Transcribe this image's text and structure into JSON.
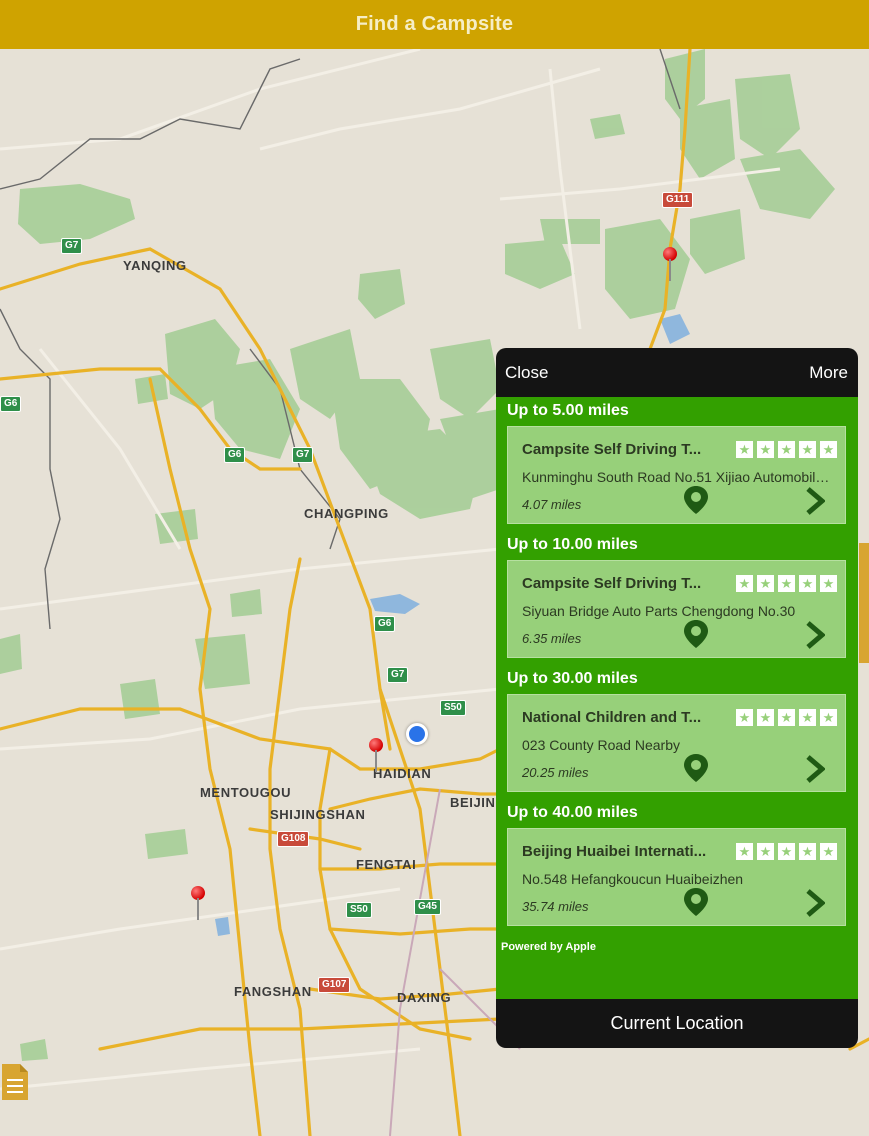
{
  "header": {
    "title": "Find a Campsite"
  },
  "map": {
    "cities": [
      {
        "name": "YANQING"
      },
      {
        "name": "CHANGPING"
      },
      {
        "name": "HAIDIAN"
      },
      {
        "name": "BEIJING"
      },
      {
        "name": "MENTOUGOU"
      },
      {
        "name": "SHIJINGSHAN"
      },
      {
        "name": "FENGTAI"
      },
      {
        "name": "FANGSHAN"
      },
      {
        "name": "DAXING"
      }
    ],
    "shields": [
      "G7",
      "G6",
      "G6",
      "G7",
      "G6",
      "G7",
      "S50",
      "G108",
      "S50",
      "G45",
      "G107",
      "G111"
    ]
  },
  "popover": {
    "close_label": "Close",
    "more_label": "More",
    "powered_by": "Powered by Apple",
    "current_location_label": "Current Location",
    "sections": [
      {
        "title": "Up to 5.00 miles",
        "name": "Campsite Self Driving T...",
        "address": "Kunminghu South Road No.51 Xijiao Automobile...",
        "distance": "4.07 miles"
      },
      {
        "title": "Up to 10.00 miles",
        "name": "Campsite Self Driving T...",
        "address": "Siyuan Bridge Auto Parts Chengdong No.30",
        "distance": "6.35 miles"
      },
      {
        "title": "Up to 30.00 miles",
        "name": "National Children and T...",
        "address": "023 County Road Nearby",
        "distance": "20.25 miles"
      },
      {
        "title": "Up to 40.00 miles",
        "name": "Beijing Huaibei Internati...",
        "address": "No.548  Hefangkoucun  Huaibeizhen",
        "distance": "35.74 miles"
      }
    ]
  },
  "colors": {
    "header": "#cfa300",
    "list_bg": "#33a000",
    "card_bg": "#97d07a"
  }
}
